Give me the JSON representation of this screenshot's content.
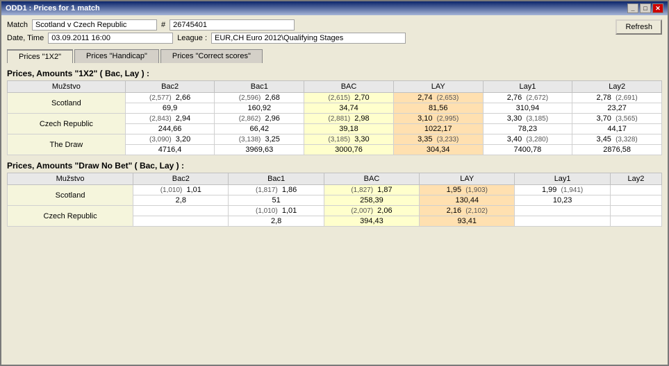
{
  "window": {
    "title": "ODD1 : Prices for 1 match"
  },
  "header": {
    "match_label": "Match",
    "match_value": "Scotland v Czech Republic",
    "match_id_label": "#",
    "match_id": "26745401",
    "date_label": "Date, Time",
    "date_value": "03.09.2011 16:00",
    "league_label": "League :",
    "league_value": "EUR,CH  Euro 2012\\Qualifying Stages",
    "refresh_label": "Refresh"
  },
  "tabs": [
    {
      "id": "1x2",
      "label": "Prices \"1X2\"",
      "active": true
    },
    {
      "id": "handicap",
      "label": "Prices \"Handicap\"",
      "active": false
    },
    {
      "id": "correct",
      "label": "Prices \"Correct scores\"",
      "active": false
    }
  ],
  "table1": {
    "title": "Prices, Amounts \"1X2\" ( Bac, Lay ) :",
    "columns": [
      "Mužstvo",
      "Bac2",
      "Bac1",
      "BAC",
      "LAY",
      "Lay1",
      "Lay2"
    ],
    "rows": [
      {
        "team": "Scotland",
        "bac2_s": "(2,577)",
        "bac2_v": "2,66",
        "bac1_s": "(2,596)",
        "bac1_v": "2,68",
        "bac_s": "(2,615)",
        "bac_v": "2,70",
        "lay_v": "2,74",
        "lay_s": "(2,653)",
        "lay1_v": "2,76",
        "lay1_s": "(2,672)",
        "lay2_v": "2,78",
        "lay2_s": "(2,691)"
      },
      {
        "team": "",
        "bac2_a": "69,9",
        "bac1_a": "160,92",
        "bac_a": "34,74",
        "lay_a": "81,56",
        "lay1_a": "310,94",
        "lay2_a": "23,27"
      },
      {
        "team": "Czech Republic",
        "bac2_s": "(2,843)",
        "bac2_v": "2,94",
        "bac1_s": "(2,862)",
        "bac1_v": "2,96",
        "bac_s": "(2,881)",
        "bac_v": "2,98",
        "lay_v": "3,10",
        "lay_s": "(2,995)",
        "lay1_v": "3,30",
        "lay1_s": "(3,185)",
        "lay2_v": "3,70",
        "lay2_s": "(3,565)"
      },
      {
        "team": "",
        "bac2_a": "244,66",
        "bac1_a": "66,42",
        "bac_a": "39,18",
        "lay_a": "1022,17",
        "lay1_a": "78,23",
        "lay2_a": "44,17"
      },
      {
        "team": "The Draw",
        "bac2_s": "(3,090)",
        "bac2_v": "3,20",
        "bac1_s": "(3,138)",
        "bac1_v": "3,25",
        "bac_s": "(3,185)",
        "bac_v": "3,30",
        "lay_v": "3,35",
        "lay_s": "(3,233)",
        "lay1_v": "3,40",
        "lay1_s": "(3,280)",
        "lay2_v": "3,45",
        "lay2_s": "(3,328)"
      },
      {
        "team": "",
        "bac2_a": "4716,4",
        "bac1_a": "3969,63",
        "bac_a": "3000,76",
        "lay_a": "304,34",
        "lay1_a": "7400,78",
        "lay2_a": "2876,58"
      }
    ]
  },
  "table2": {
    "title": "Prices, Amounts \"Draw No Bet\" ( Bac, Lay ) :",
    "columns": [
      "Mužstvo",
      "Bac2",
      "Bac1",
      "BAC",
      "LAY",
      "Lay1",
      "Lay2"
    ],
    "rows": [
      {
        "team": "Scotland",
        "bac2_s": "(1,010)",
        "bac2_v": "1,01",
        "bac1_s": "(1,817)",
        "bac1_v": "1,86",
        "bac_s": "(1,827)",
        "bac_v": "1,87",
        "lay_v": "1,95",
        "lay_s": "(1,903)",
        "lay1_v": "1,99",
        "lay1_s": "(1,941)",
        "lay2_v": "",
        "lay2_s": ""
      },
      {
        "team": "",
        "bac2_a": "2,8",
        "bac1_a": "51",
        "bac_a": "258,39",
        "lay_a": "130,44",
        "lay1_a": "10,23",
        "lay2_a": ""
      },
      {
        "team": "Czech Republic",
        "bac2_s": "",
        "bac2_v": "",
        "bac1_s": "(1,010)",
        "bac1_v": "1,01",
        "bac_s": "(2,007)",
        "bac_v": "2,06",
        "lay_v": "2,16",
        "lay_s": "(2,102)",
        "lay1_v": "",
        "lay1_s": "",
        "lay2_v": "",
        "lay2_s": ""
      },
      {
        "team": "",
        "bac2_a": "",
        "bac1_a": "2,8",
        "bac_a": "394,43",
        "lay_a": "93,41",
        "lay1_a": "",
        "lay2_a": ""
      }
    ]
  }
}
